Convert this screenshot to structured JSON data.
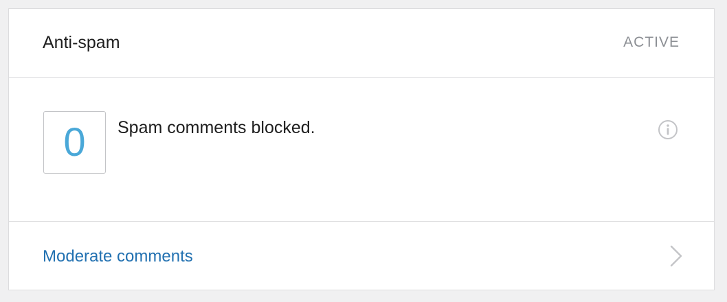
{
  "card": {
    "title": "Anti-spam",
    "status": "ACTIVE",
    "stat": {
      "value": "0",
      "label": "Spam comments blocked."
    },
    "info_icon": "info-icon",
    "footer": {
      "link_label": "Moderate comments",
      "chevron_icon": "chevron-right-icon"
    }
  },
  "colors": {
    "accent": "#4aa8d8",
    "link": "#2271b1",
    "muted": "#8c8f94",
    "border": "#dcdcde"
  }
}
